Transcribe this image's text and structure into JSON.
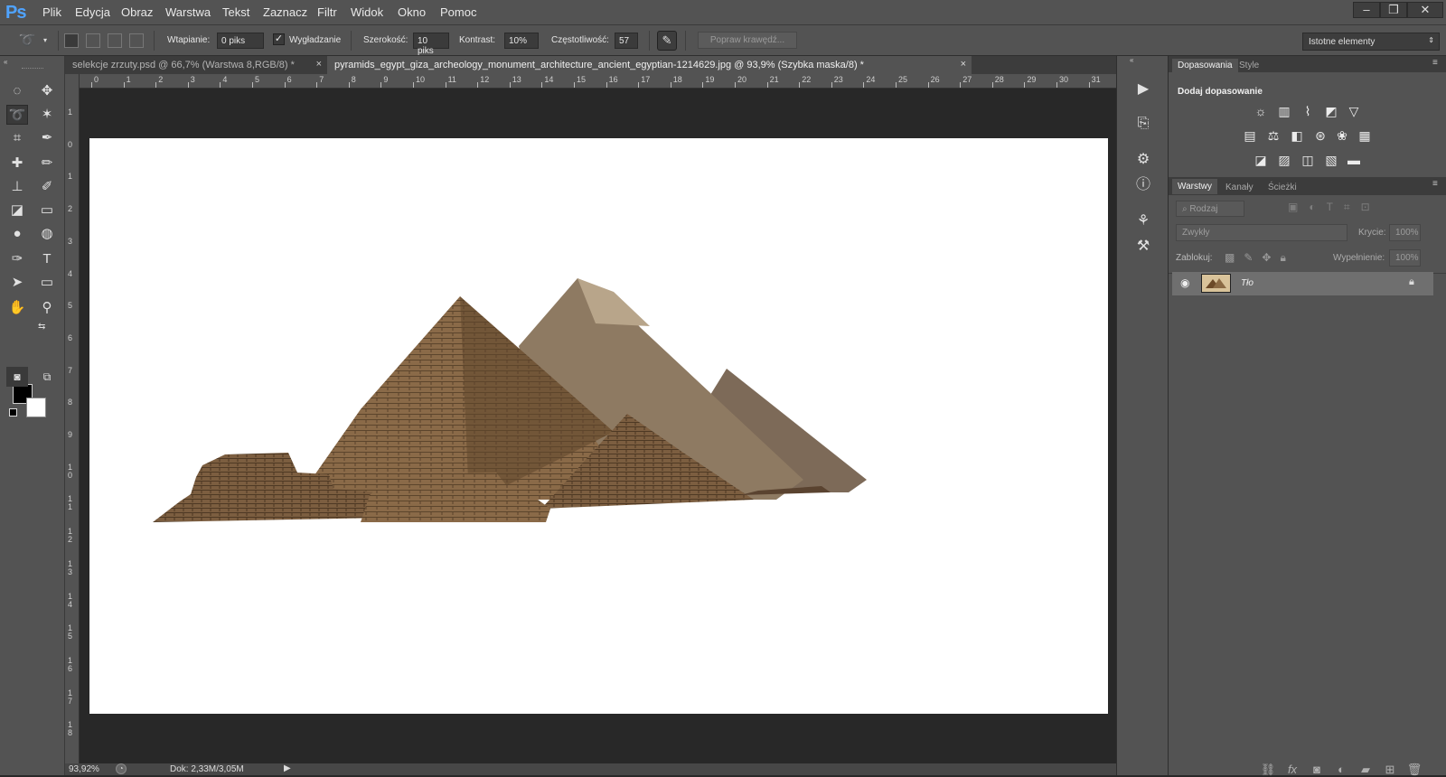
{
  "app": {
    "logo": "Ps"
  },
  "menu": [
    "Plik",
    "Edycja",
    "Obraz",
    "Warstwa",
    "Tekst",
    "Zaznacz",
    "Filtr",
    "Widok",
    "Okno",
    "Pomoc"
  ],
  "window_controls": {
    "minimize": "–",
    "restore": "❐",
    "close": "✕"
  },
  "options": {
    "feather_label": "Wtapianie:",
    "feather_value": "0 piks",
    "smoothing_label": "Wygładzanie",
    "width_label": "Szerokość:",
    "width_value": "10 piks",
    "contrast_label": "Kontrast:",
    "contrast_value": "10%",
    "frequency_label": "Częstotliwość:",
    "frequency_value": "57",
    "refine_edge": "Popraw krawędź...",
    "workspace": "Istotne elementy"
  },
  "tabs": [
    {
      "label": "selekcje zrzuty.psd @ 66,7% (Warstwa 8,RGB/8) *",
      "close": "×"
    },
    {
      "label": "pyramids_egypt_giza_archeology_monument_architecture_ancient_egyptian-1214629.jpg @ 93,9% (Szybka maska/8) *",
      "close": "×"
    }
  ],
  "ruler": {
    "top": [
      "0",
      "1",
      "2",
      "3",
      "4",
      "5",
      "6",
      "7",
      "8",
      "9",
      "10",
      "11",
      "12",
      "13",
      "14",
      "15",
      "16",
      "17",
      "18",
      "19",
      "20",
      "21",
      "22",
      "23",
      "24",
      "25",
      "26",
      "27",
      "28",
      "29",
      "30",
      "31"
    ],
    "left": [
      "1",
      "0",
      "1",
      "2",
      "3",
      "4",
      "5",
      "6",
      "7",
      "8",
      "9",
      "1 0",
      "1 1",
      "1 2",
      "1 3",
      "1 4",
      "1 5",
      "1 6",
      "1 7",
      "1 8"
    ]
  },
  "status": {
    "zoom": "93,92%",
    "doc": "Dok: 2,33M/3,05M",
    "arrow": "▶"
  },
  "adjustments": {
    "tab": "Dopasowania",
    "tab2": "Style",
    "heading": "Dodaj dopasowanie"
  },
  "layers_panel": {
    "tabs": [
      "Warstwy",
      "Kanały",
      "Ścieżki"
    ],
    "filter": "Rodzaj",
    "blend_mode": "Zwykły",
    "opacity_label": "Krycie:",
    "opacity_value": "100%",
    "lock_label": "Zablokuj:",
    "fill_label": "Wypełnienie:",
    "fill_value": "100%",
    "layers": [
      {
        "name": "Tło",
        "visible": true,
        "locked": true
      }
    ]
  },
  "icons": {
    "tools": [
      "marquee-icon",
      "move-icon",
      "lasso-icon",
      "magic-wand-icon",
      "crop-icon",
      "eyedropper-icon",
      "healing-icon",
      "brush-icon",
      "stamp-icon",
      "history-brush-icon",
      "eraser-icon",
      "gradient-icon",
      "blur-icon",
      "dodge-icon",
      "pen-icon",
      "type-icon",
      "path-select-icon",
      "shape-icon",
      "hand-icon",
      "zoom-icon"
    ]
  }
}
